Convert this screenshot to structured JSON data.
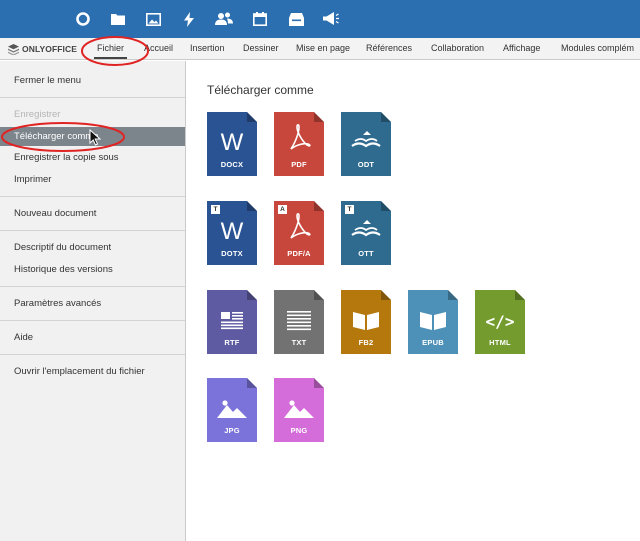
{
  "toolbar": {
    "icons": [
      "circle-icon",
      "folder-icon",
      "image-icon",
      "bolt-icon",
      "users-icon",
      "calendar-icon",
      "inbox-icon",
      "megaphone-icon"
    ]
  },
  "menubar": {
    "logo_text": "ONLYOFFICE",
    "tabs": [
      {
        "label": "Fichier",
        "active": true
      },
      {
        "label": "Accueil"
      },
      {
        "label": "Insertion"
      },
      {
        "label": "Dessiner"
      },
      {
        "label": "Mise en page"
      },
      {
        "label": "Références"
      },
      {
        "label": "Collaboration"
      },
      {
        "label": "Affichage"
      },
      {
        "label": "Modules complém"
      }
    ]
  },
  "sidebar": {
    "items": [
      {
        "label": "Fermer le menu"
      },
      {
        "label": "Enregistrer",
        "disabled": true
      },
      {
        "label": "Télécharger comme",
        "selected": true
      },
      {
        "label": "Enregistrer la copie sous"
      },
      {
        "label": "Imprimer"
      },
      {
        "label": "Nouveau document"
      },
      {
        "label": "Descriptif du document"
      },
      {
        "label": "Historique des versions"
      },
      {
        "label": "Paramètres avancés"
      },
      {
        "label": "Aide"
      },
      {
        "label": "Ouvrir l'emplacement du fichier"
      }
    ]
  },
  "panel": {
    "title": "Télécharger comme",
    "formats": [
      {
        "label": "DOCX",
        "color": "#2a5394",
        "glyph": "word"
      },
      {
        "label": "PDF",
        "color": "#c8473c",
        "glyph": "pdf"
      },
      {
        "label": "ODT",
        "color": "#2f6b8f",
        "glyph": "odt"
      },
      {
        "label": "DOTX",
        "color": "#2a5394",
        "glyph": "word",
        "badge": "T"
      },
      {
        "label": "PDF/A",
        "color": "#c8473c",
        "glyph": "pdf",
        "badge": "A"
      },
      {
        "label": "OTT",
        "color": "#2f6b8f",
        "glyph": "odt",
        "badge": "T"
      },
      {
        "label": "RTF",
        "color": "#5f5ba2",
        "glyph": "rtf"
      },
      {
        "label": "TXT",
        "color": "#727272",
        "glyph": "txt"
      },
      {
        "label": "FB2",
        "color": "#b5780d",
        "glyph": "book"
      },
      {
        "label": "EPUB",
        "color": "#4d90b8",
        "glyph": "book"
      },
      {
        "label": "HTML",
        "color": "#749b2e",
        "glyph": "code"
      },
      {
        "label": "JPG",
        "color": "#7b73d9",
        "glyph": "image"
      },
      {
        "label": "PNG",
        "color": "#d46cd9",
        "glyph": "image"
      }
    ]
  },
  "colors": {
    "topbar": "#2b6fb1",
    "annotation": "#e02424"
  }
}
